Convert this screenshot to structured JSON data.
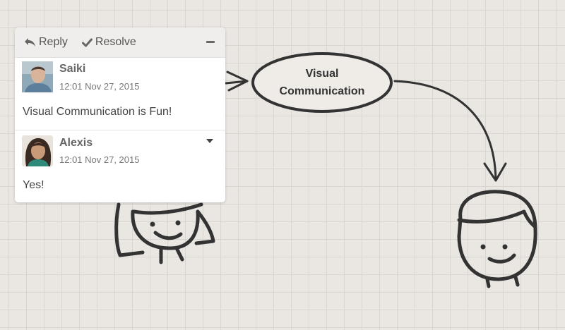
{
  "toolbar": {
    "reply_label": "Reply",
    "resolve_label": "Resolve",
    "reply_icon": "reply-arrow-icon",
    "resolve_icon": "checkmark-icon",
    "minimize_icon": "minus-icon"
  },
  "comments": [
    {
      "author": "Saiki",
      "time": "12:01 Nov 27, 2015",
      "text": "Visual Communication is Fun!",
      "avatar": "avatar-photo"
    },
    {
      "author": "Alexis",
      "time": "12:01 Nov 27, 2015",
      "text": "Yes!",
      "avatar": "avatar-photo",
      "menu_icon": "caret-down-icon"
    }
  ],
  "diagram": {
    "node_line1": "Visual",
    "node_line2": "Communication"
  },
  "colors": {
    "canvas_bg": "#eae7e3",
    "grid_line": "#d9d5d0",
    "ink": "#333333",
    "toolbar_bg": "#f0eeec"
  }
}
